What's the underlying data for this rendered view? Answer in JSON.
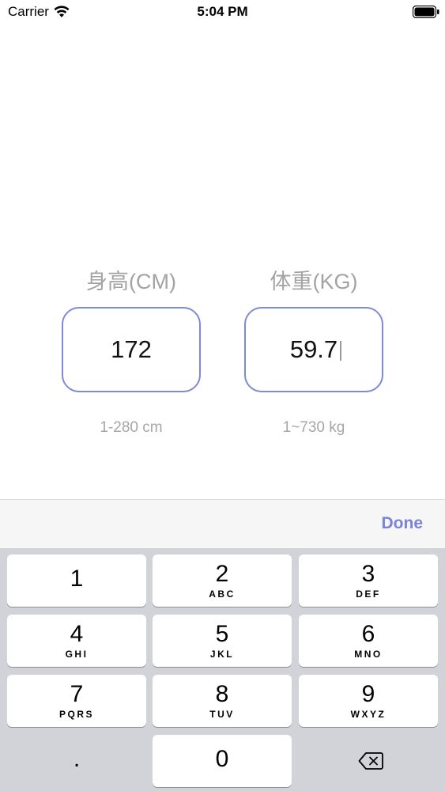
{
  "status_bar": {
    "carrier": "Carrier",
    "time": "5:04 PM",
    "wifi_icon": "wifi-icon",
    "battery_icon": "battery-icon"
  },
  "fields": {
    "height": {
      "label": "身高(CM)",
      "value": "172",
      "range": "1-280 cm"
    },
    "weight": {
      "label": "体重(KG)",
      "value": "59.7",
      "range": "1~730 kg"
    }
  },
  "toolbar": {
    "done_label": "Done"
  },
  "keypad": {
    "keys": [
      {
        "digit": "1",
        "letters": ""
      },
      {
        "digit": "2",
        "letters": "ABC"
      },
      {
        "digit": "3",
        "letters": "DEF"
      },
      {
        "digit": "4",
        "letters": "GHI"
      },
      {
        "digit": "5",
        "letters": "JKL"
      },
      {
        "digit": "6",
        "letters": "MNO"
      },
      {
        "digit": "7",
        "letters": "PQRS"
      },
      {
        "digit": "8",
        "letters": "TUV"
      },
      {
        "digit": "9",
        "letters": "WXYZ"
      },
      {
        "digit": "0",
        "letters": ""
      }
    ],
    "dot_label": ".",
    "delete_icon": "delete-backspace-icon"
  },
  "colors": {
    "accent": "#7a84d3",
    "field_border": "#8089d6",
    "label_gray": "#a3a3a3",
    "keypad_bg": "#d1d3d9"
  }
}
